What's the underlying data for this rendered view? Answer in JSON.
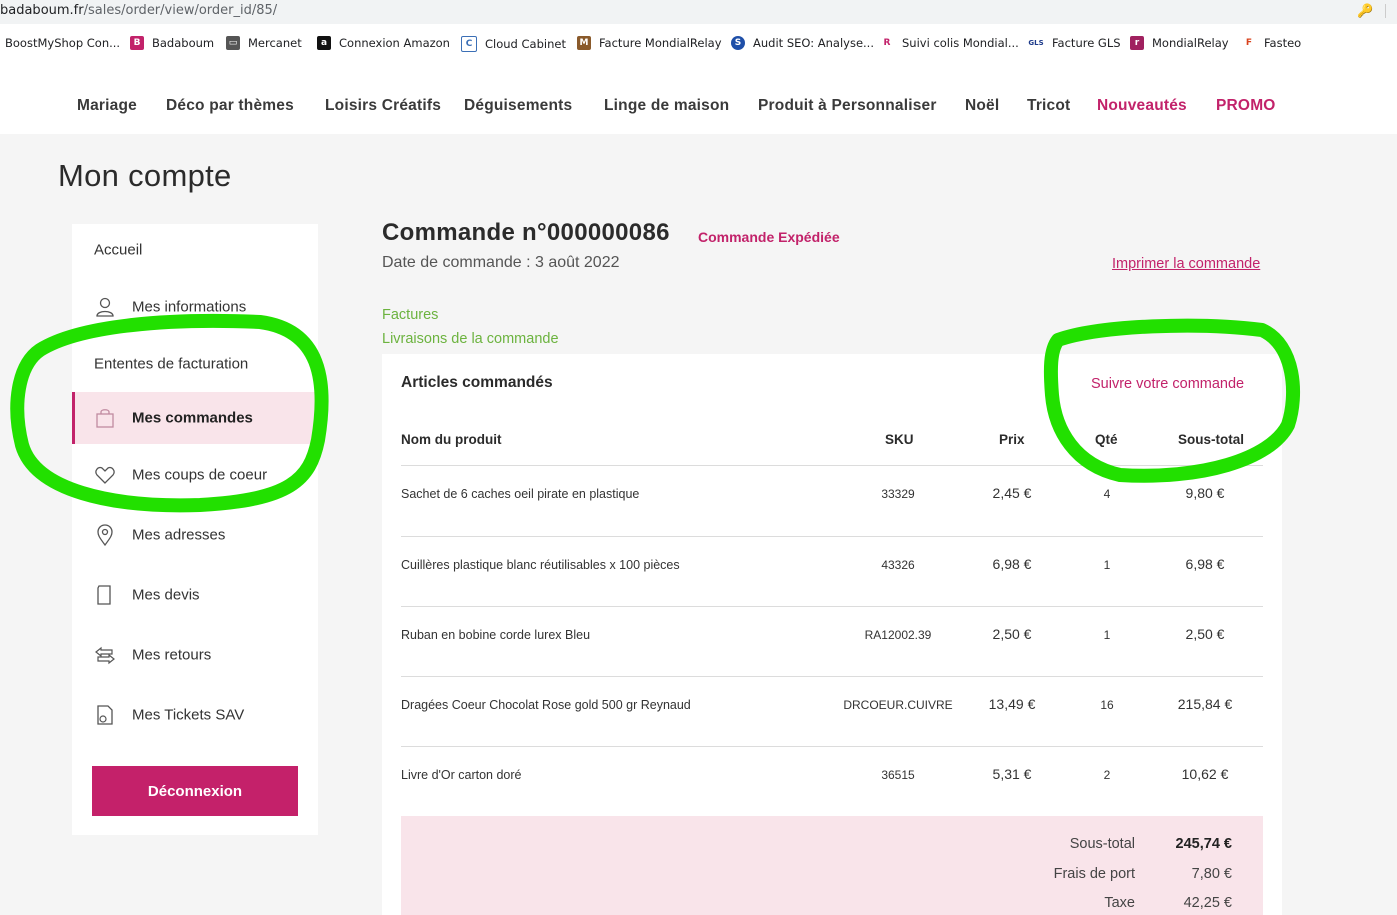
{
  "browser": {
    "url_host": "badaboum.fr",
    "url_path": "/sales/order/view/order_id/85/"
  },
  "bookmarks": [
    {
      "label": "BoostMyShop Con...",
      "icon": "none",
      "color": ""
    },
    {
      "label": "Badaboum",
      "icon": "BB",
      "color": "#c2226a"
    },
    {
      "label": "Mercanet",
      "icon": "card-icon",
      "color": "#555555"
    },
    {
      "label": "Connexion Amazon",
      "icon": "a",
      "color": "#111111"
    },
    {
      "label": "Cloud Cabinet",
      "icon": "C",
      "color": "#3b6fb6"
    },
    {
      "label": "Facture MondialRelay",
      "icon": "M",
      "color": "#8a5a2b"
    },
    {
      "label": "Audit SEO: Analyse...",
      "icon": "S",
      "color": "#1e4fa8"
    },
    {
      "label": "Suivi colis Mondial...",
      "icon": "R",
      "color": "#c2226a"
    },
    {
      "label": "Facture GLS",
      "icon": "GLS",
      "color": "#1d3a8a"
    },
    {
      "label": "MondialRelay",
      "icon": "r",
      "color": "#a0215f"
    },
    {
      "label": "Fasteo",
      "icon": "F",
      "color": "#d9431e"
    }
  ],
  "nav": {
    "items": [
      "Mariage",
      "Déco par thèmes",
      "Loisirs Créatifs",
      "Déguisements",
      "Linge de maison",
      "Produit à Personnaliser",
      "Noël",
      "Tricot"
    ],
    "highlight": [
      "Nouveautés",
      "PROMO"
    ]
  },
  "page_title": "Mon compte",
  "sidebar": {
    "items": [
      {
        "label": "Accueil",
        "icon": ""
      },
      {
        "label": "Mes informations",
        "icon": "user-icon"
      },
      {
        "label": "Ententes de facturation",
        "icon": ""
      },
      {
        "label": "Mes commandes",
        "icon": "bag-icon"
      },
      {
        "label": "Mes coups de coeur",
        "icon": "heart-icon"
      },
      {
        "label": "Mes adresses",
        "icon": "pin-icon"
      },
      {
        "label": "Mes devis",
        "icon": "document-icon"
      },
      {
        "label": "Mes retours",
        "icon": "return-icon"
      },
      {
        "label": "Mes Tickets SAV",
        "icon": "ticket-icon"
      }
    ],
    "active": "Mes commandes",
    "logout": "Déconnexion"
  },
  "order": {
    "title": "Commande n°000000086",
    "status": "Commande Expédiée",
    "date": "Date de commande : 3 août 2022",
    "print": "Imprimer la commande",
    "links": [
      "Factures",
      "Livraisons de la commande"
    ]
  },
  "items_panel": {
    "title": "Articles commandés",
    "track": "Suivre votre commande",
    "headers": [
      "Nom du produit",
      "SKU",
      "Prix",
      "Qté",
      "Sous-total"
    ],
    "rows": [
      {
        "name": "Sachet de 6 caches oeil pirate en plastique",
        "sku": "33329",
        "price": "2,45 €",
        "qty": "4",
        "subtotal": "9,80 €"
      },
      {
        "name": "Cuillères plastique blanc réutilisables x 100 pièces",
        "sku": "43326",
        "price": "6,98 €",
        "qty": "1",
        "subtotal": "6,98 €"
      },
      {
        "name": "Ruban en bobine corde lurex Bleu",
        "sku": "RA12002.39",
        "price": "2,50 €",
        "qty": "1",
        "subtotal": "2,50 €"
      },
      {
        "name": "Dragées Coeur Chocolat Rose gold 500 gr Reynaud",
        "sku": "DRCOEUR.CUIVRE",
        "price": "13,49 €",
        "qty": "16",
        "subtotal": "215,84 €"
      },
      {
        "name": "Livre d'Or carton doré",
        "sku": "36515",
        "price": "5,31 €",
        "qty": "2",
        "subtotal": "10,62 €"
      }
    ]
  },
  "totals": [
    {
      "label": "Sous-total",
      "value": "245,74 €"
    },
    {
      "label": "Frais de port",
      "value": "7,80 €"
    },
    {
      "label": "Taxe",
      "value": "42,25 €"
    }
  ],
  "colors": {
    "brand": "#c2226a",
    "link_green": "#6cb33f",
    "highlight": "#f9e4ea",
    "annotation": "#22e000"
  }
}
